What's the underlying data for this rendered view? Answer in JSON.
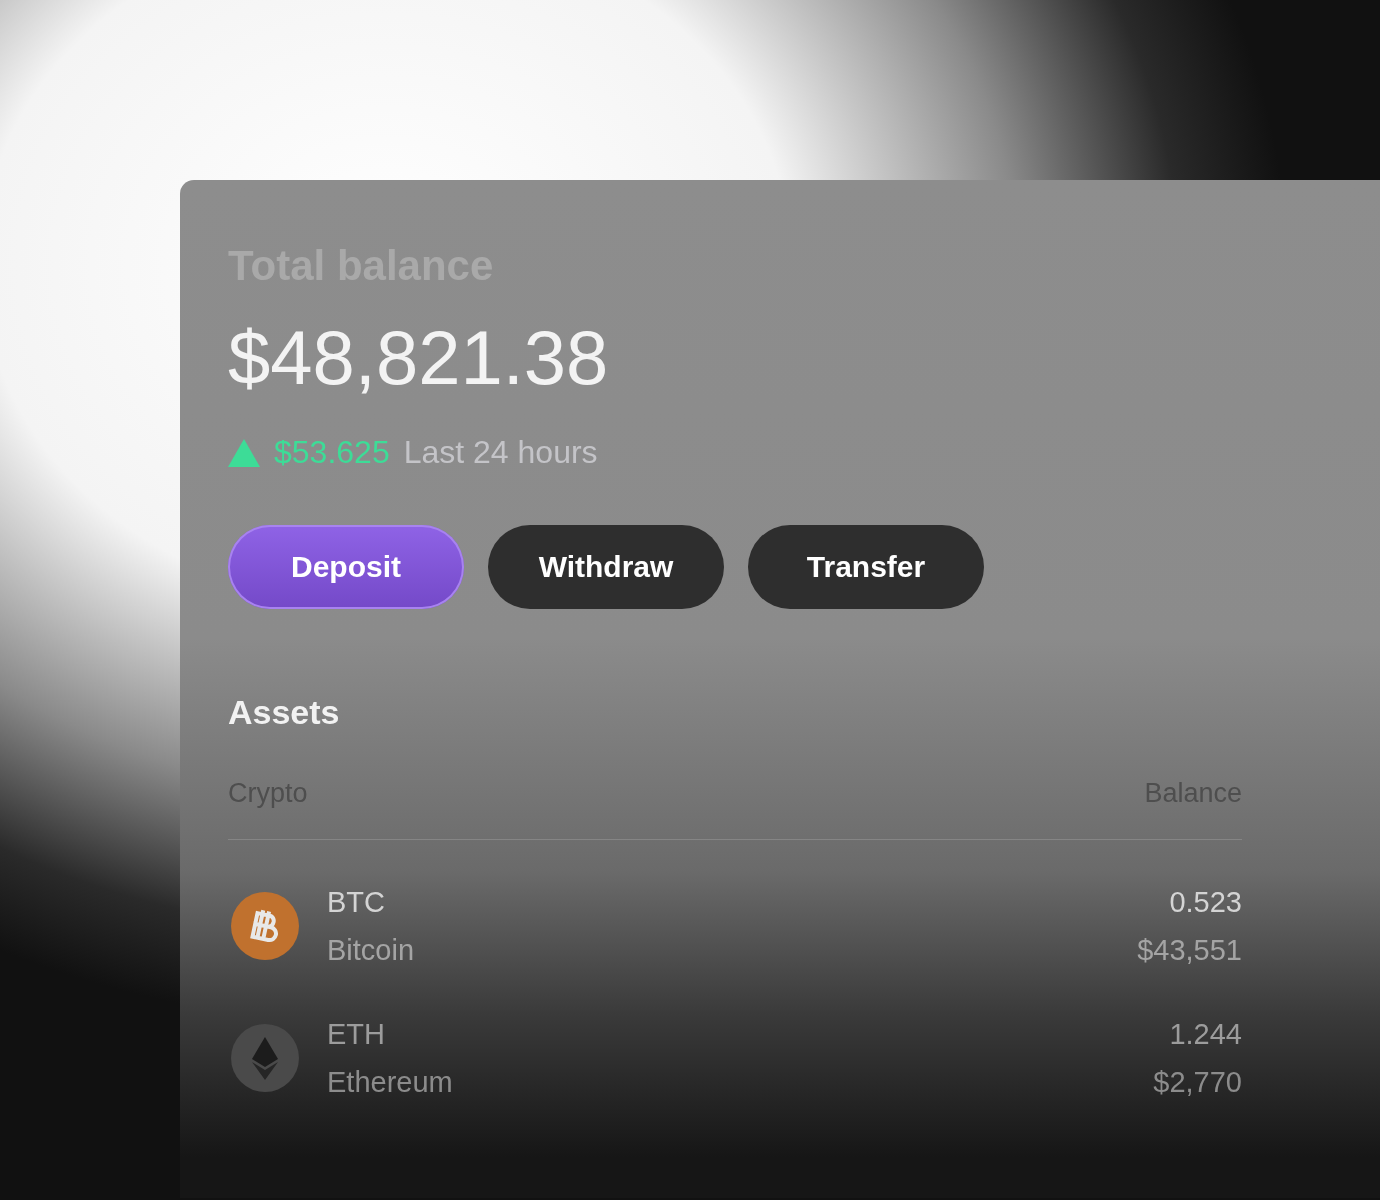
{
  "balance": {
    "title": "Total balance",
    "amount": "$48,821.38",
    "change": {
      "rising": true,
      "amount": "$53.625",
      "period": "Last 24 hours"
    }
  },
  "buttons": [
    {
      "label": "Deposit",
      "primary": true
    },
    {
      "label": "Withdraw",
      "primary": false
    },
    {
      "label": "Transfer",
      "primary": false
    }
  ],
  "assets": {
    "title": "Assets",
    "columns": [
      "Crypto",
      "Balance"
    ],
    "rows": [
      {
        "kind": "bitcoin",
        "symbol": "BTC",
        "name": "Bitcoin",
        "amount": "0.523",
        "value": "$43,551",
        "color": "#c0712e"
      },
      {
        "kind": "ethereum",
        "symbol": "ETH",
        "name": "Ethereum",
        "amount": "1.244",
        "value": "$2,770",
        "color": "#4a4a4a"
      }
    ]
  }
}
